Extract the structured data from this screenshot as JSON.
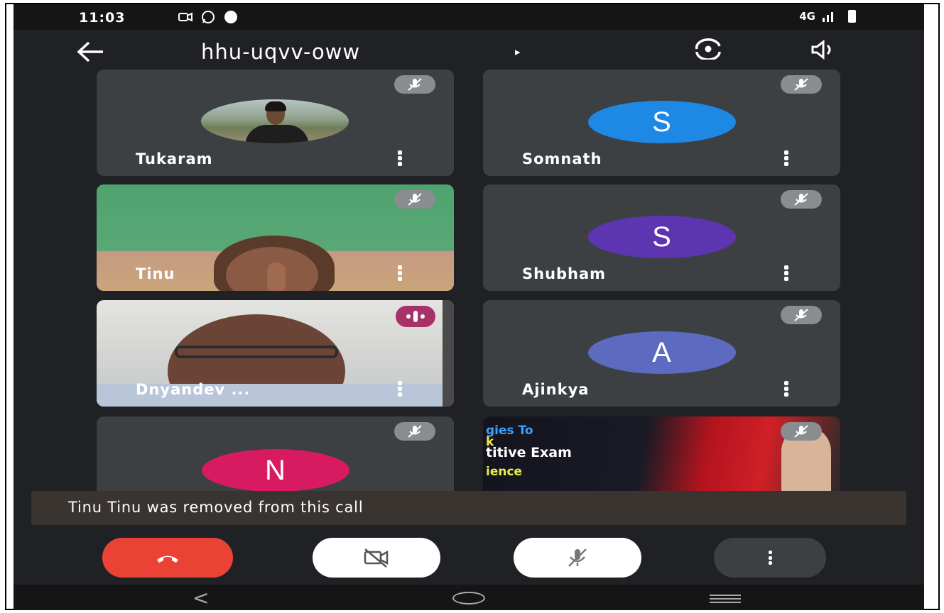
{
  "status_bar": {
    "time": "11:03",
    "notification_icons": [
      "camera-icon",
      "whatsapp-icon",
      "chat-icon"
    ],
    "network": "4G"
  },
  "header": {
    "meeting_code": "hhu-uqvv-oww",
    "arrow": "▸",
    "back_icon": "back-arrow-icon",
    "switch_camera_icon": "switch-camera-icon",
    "speaker_icon": "speaker-icon"
  },
  "participants": [
    {
      "name": "Tukaram",
      "type": "photo",
      "muted": true
    },
    {
      "name": "Somnath",
      "type": "initial",
      "initial": "S",
      "color": "#1e88e5",
      "muted": true
    },
    {
      "name": "Tinu",
      "type": "video",
      "muted": true
    },
    {
      "name": "Shubham",
      "type": "initial",
      "initial": "S",
      "color": "#5e35b1",
      "muted": true
    },
    {
      "name": "Dnyandev ...",
      "type": "video",
      "speaking": true
    },
    {
      "name": "Ajinkya",
      "type": "initial",
      "initial": "A",
      "color": "#5c6bc0",
      "muted": true
    },
    {
      "name": "",
      "type": "initial",
      "initial": "N",
      "color": "#d81b60",
      "muted": true
    },
    {
      "name": "",
      "type": "video",
      "muted": true
    }
  ],
  "banner_video_text": {
    "line1": "gies To",
    "line2": "k",
    "line3": "titive Exam",
    "line4": "ience"
  },
  "toast": {
    "message": "Tinu Tinu was removed from this call"
  },
  "controls": {
    "hangup": "hang-up-icon",
    "camera": "camera-off-icon",
    "mic": "mic-off-icon",
    "more": "more-options-icon"
  },
  "navbar": {
    "back": "<"
  },
  "colors": {
    "background": "#202124",
    "tile": "#3c4043",
    "hangup": "#ea4335",
    "speaking": "#a8316a"
  }
}
